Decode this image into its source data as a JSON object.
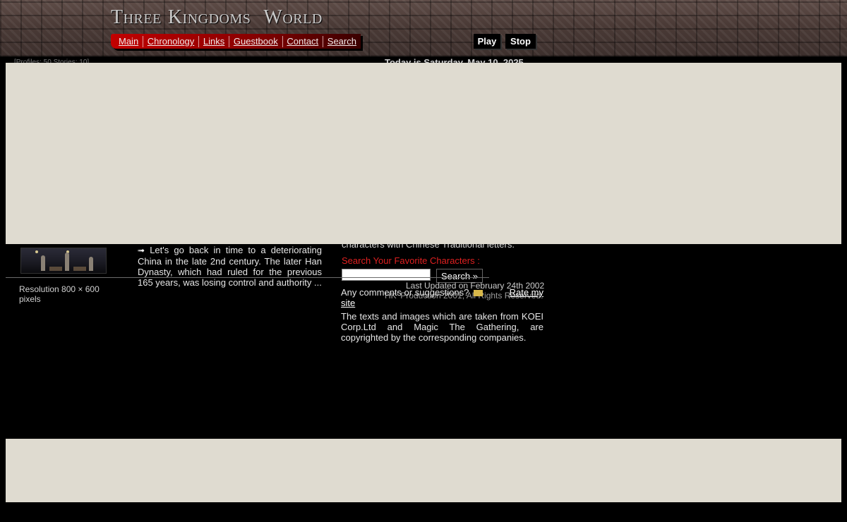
{
  "site": {
    "title_parts": [
      "Three",
      "Kingdoms",
      "World"
    ]
  },
  "nav": {
    "items": [
      {
        "label": "Main"
      },
      {
        "label": "Chronology"
      },
      {
        "label": "Links"
      },
      {
        "label": "Guestbook"
      },
      {
        "label": "Contact"
      },
      {
        "label": "Search"
      }
    ]
  },
  "player": {
    "play_label": "Play",
    "stop_label": "Stop"
  },
  "peek": {
    "top_left": "[Profiles: 50 Stories: 10]",
    "date": "Today is Saturday, May 10, 2025",
    "chars_line": "characters with Chinese Traditional letters."
  },
  "left": {
    "resolution": "Resolution 800 × 600 pixels"
  },
  "story": {
    "arrow_icon": "➟",
    "text": "Let's go back in time to a deteriorating China in the late 2nd century. The later Han Dynasty, which had ruled for the previous 165 years, was losing control and authority ..."
  },
  "search": {
    "label": "Search Your Favorite Characters :",
    "input_value": "",
    "button_label": "Search »"
  },
  "footer": {
    "last_updated": "Last Updated on February 24th 2002",
    "copyright": "HK' Production 2001, All Rights Reserved.",
    "comments_text": "Any comments or suggestions?",
    "rate_label": "Rate my",
    "site_label": "site",
    "disclaimer": "The texts and images which are taken from KOEI Corp.Ltd and Magic The Gathering, are copyrighted by the corresponding companies."
  },
  "colors": {
    "nav_red": "#c20000",
    "overlay": "#dfdbd0",
    "search_label_red": "#e02020",
    "background": "#000000"
  }
}
